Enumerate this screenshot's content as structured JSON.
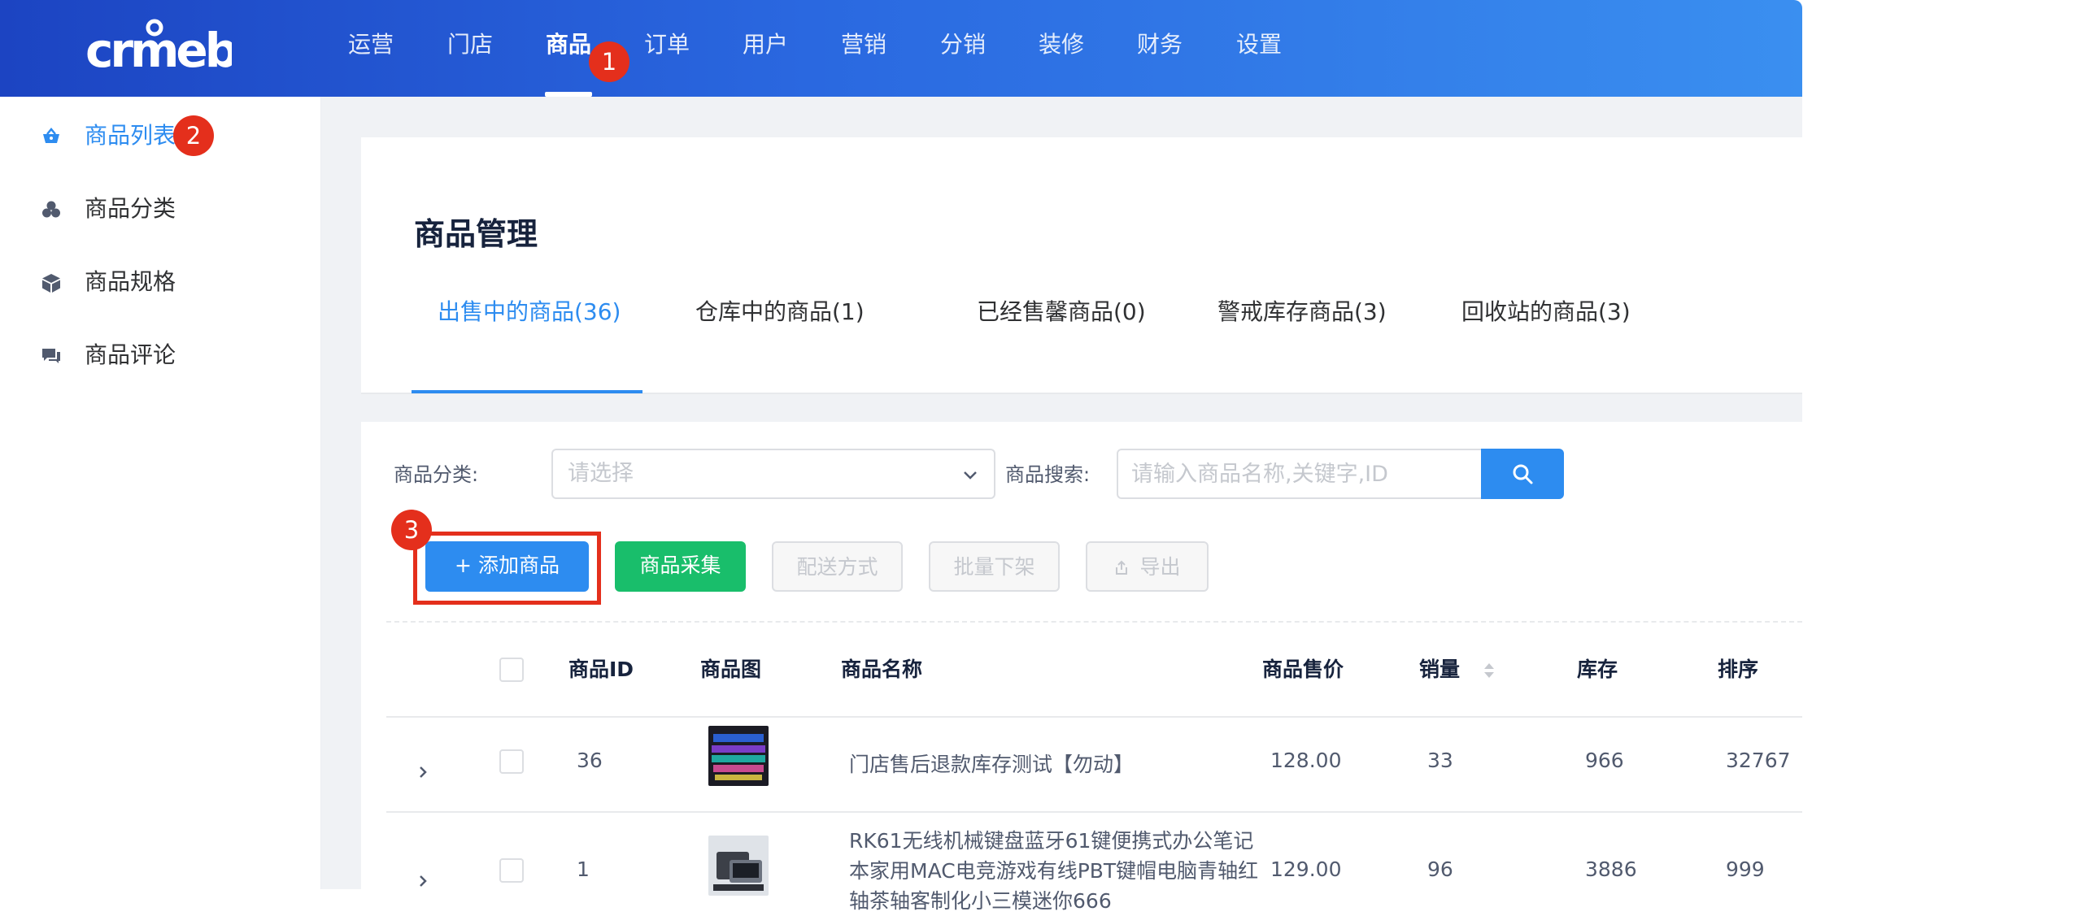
{
  "header": {
    "logo": "crmeb",
    "nav": [
      "运营",
      "门店",
      "商品",
      "订单",
      "用户",
      "营销",
      "分销",
      "装修",
      "财务",
      "设置"
    ],
    "active_index": 2,
    "marker_1": "1"
  },
  "sidebar": {
    "items": [
      {
        "label": "商品列表",
        "icon": "basket-icon",
        "active": true
      },
      {
        "label": "商品分类",
        "icon": "category-icon",
        "active": false
      },
      {
        "label": "商品规格",
        "icon": "cube-icon",
        "active": false
      },
      {
        "label": "商品评论",
        "icon": "comment-icon",
        "active": false
      }
    ],
    "marker_2": "2"
  },
  "page": {
    "title": "商品管理",
    "tabs": [
      "出售中的商品(36)",
      "仓库中的商品(1)",
      "已经售馨商品(0)",
      "警戒库存商品(3)",
      "回收站的商品(3)"
    ],
    "active_tab": 0
  },
  "filters": {
    "category_label": "商品分类:",
    "category_placeholder": "请选择",
    "search_label": "商品搜索:",
    "search_placeholder": "请输入商品名称,关键字,ID"
  },
  "actions": {
    "add": "+ 添加商品",
    "collect": "商品采集",
    "shipping": "配送方式",
    "batch_off": "批量下架",
    "export": "导出",
    "marker_3": "3"
  },
  "table": {
    "columns": [
      "商品ID",
      "商品图",
      "商品名称",
      "商品售价",
      "销量",
      "库存",
      "排序"
    ],
    "rows": [
      {
        "id": "36",
        "name": "门店售后退款库存测试【勿动】",
        "price": "128.00",
        "sales": "33",
        "stock": "966",
        "sort": "32767"
      },
      {
        "id": "1",
        "name_lines": [
          "RK61无线机械键盘蓝牙61键便携式办公笔记",
          "本家用MAC电竞游戏有线PBT键帽电脑青轴红",
          "轴茶轴客制化小三模迷你666"
        ],
        "price": "129.00",
        "sales": "96",
        "stock": "3886",
        "sort": "999"
      }
    ]
  },
  "colors": {
    "primary": "#2d8cf0",
    "success": "#19be6b",
    "marker": "#e42f1c",
    "header_start": "#1c44c2",
    "header_end": "#3a8ff0"
  }
}
